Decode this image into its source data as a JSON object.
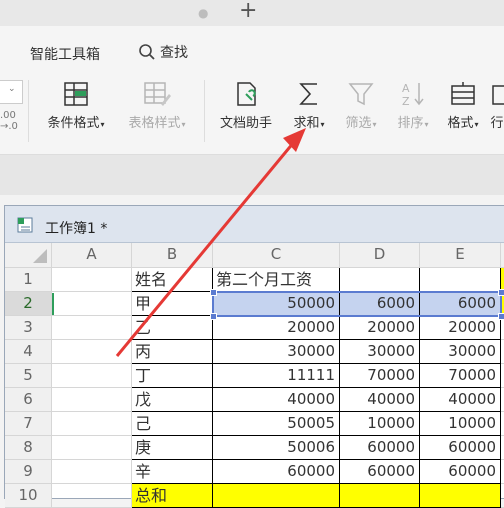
{
  "tabstrip": {
    "new_tab_symbol": "+",
    "dot": "●"
  },
  "menubar": {
    "smart_toolbox": "智能工具箱",
    "find": "查找"
  },
  "ribbon": {
    "buttons": [
      {
        "id": "cond-format",
        "label": "条件格式",
        "arrow": "▾",
        "icon": "conditional-format-icon",
        "enabled": true
      },
      {
        "id": "table-style",
        "label": "表格样式",
        "arrow": "▾",
        "icon": "table-style-icon",
        "enabled": false
      },
      {
        "id": "doc-helper",
        "label": "文档助手",
        "arrow": "",
        "icon": "document-helper-icon",
        "enabled": true
      },
      {
        "id": "sum",
        "label": "求和",
        "arrow": "▾",
        "icon": "sigma-icon",
        "enabled": true
      },
      {
        "id": "filter",
        "label": "筛选",
        "arrow": "▾",
        "icon": "filter-icon",
        "enabled": false
      },
      {
        "id": "sort",
        "label": "排序",
        "arrow": "▾",
        "icon": "sort-icon",
        "enabled": false
      },
      {
        "id": "format",
        "label": "格式",
        "arrow": "▾",
        "icon": "format-icon",
        "enabled": true
      },
      {
        "id": "rowcol",
        "label": "行",
        "arrow": "",
        "icon": "row-col-icon",
        "enabled": true
      }
    ],
    "left_partial": {
      "top": ".00",
      "bottom": "→.0"
    }
  },
  "workbook": {
    "title": "工作簿1 *"
  },
  "sheet": {
    "columns": [
      "A",
      "B",
      "C",
      "D",
      "E"
    ],
    "rows": [
      {
        "n": "1",
        "B": "姓名",
        "C": "第二个月工资",
        "D": "",
        "E": ""
      },
      {
        "n": "2",
        "B": "甲",
        "C": "50000",
        "D": "6000",
        "E": "6000"
      },
      {
        "n": "3",
        "B": "乙",
        "C": "20000",
        "D": "20000",
        "E": "20000"
      },
      {
        "n": "4",
        "B": "丙",
        "C": "30000",
        "D": "30000",
        "E": "30000"
      },
      {
        "n": "5",
        "B": "丁",
        "C": "11111",
        "D": "70000",
        "E": "70000"
      },
      {
        "n": "6",
        "B": "戊",
        "C": "40000",
        "D": "40000",
        "E": "40000"
      },
      {
        "n": "7",
        "B": "己",
        "C": "50005",
        "D": "10000",
        "E": "10000"
      },
      {
        "n": "8",
        "B": "庚",
        "C": "50006",
        "D": "60000",
        "E": "60000"
      },
      {
        "n": "9",
        "B": "辛",
        "C": "60000",
        "D": "60000",
        "E": "60000"
      },
      {
        "n": "10",
        "B": "总和",
        "C": "",
        "D": "",
        "E": ""
      }
    ],
    "active_row": "2",
    "colors": {
      "selection": "#c5d3ef",
      "highlight": "#ffff00",
      "annotation": "#e53935"
    }
  }
}
